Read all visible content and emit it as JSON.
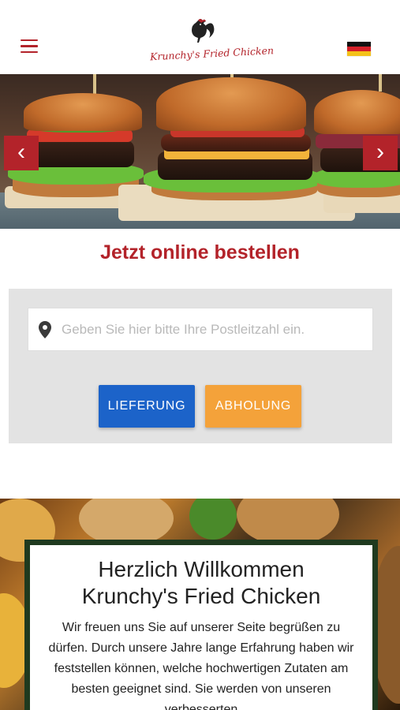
{
  "header": {
    "menu_icon": "hamburger-menu-icon",
    "logo_text": "Krunchy's Fried Chicken",
    "language_flag": "germany-flag-icon",
    "brand_color": "#b3232a"
  },
  "hero": {
    "prev_icon": "‹",
    "next_icon": "›"
  },
  "order": {
    "title": "Jetzt online bestellen",
    "search_placeholder": "Geben Sie hier bitte Ihre Postleitzahl ein.",
    "search_value": "",
    "delivery_label": "LIEFERUNG",
    "pickup_label": "ABHOLUNG",
    "delivery_color": "#1c63c9",
    "pickup_color": "#f4a23a"
  },
  "welcome": {
    "title_line1": "Herzlich Willkommen",
    "title_line2": "Krunchy's Fried Chicken",
    "text": "Wir freuen uns Sie auf unserer Seite begrüßen zu dürfen. Durch unsere Jahre lange Erfahrung haben wir feststellen können, welche hochwertigen Zutaten am besten geeignet sind. Sie werden von unseren verbesserten"
  }
}
